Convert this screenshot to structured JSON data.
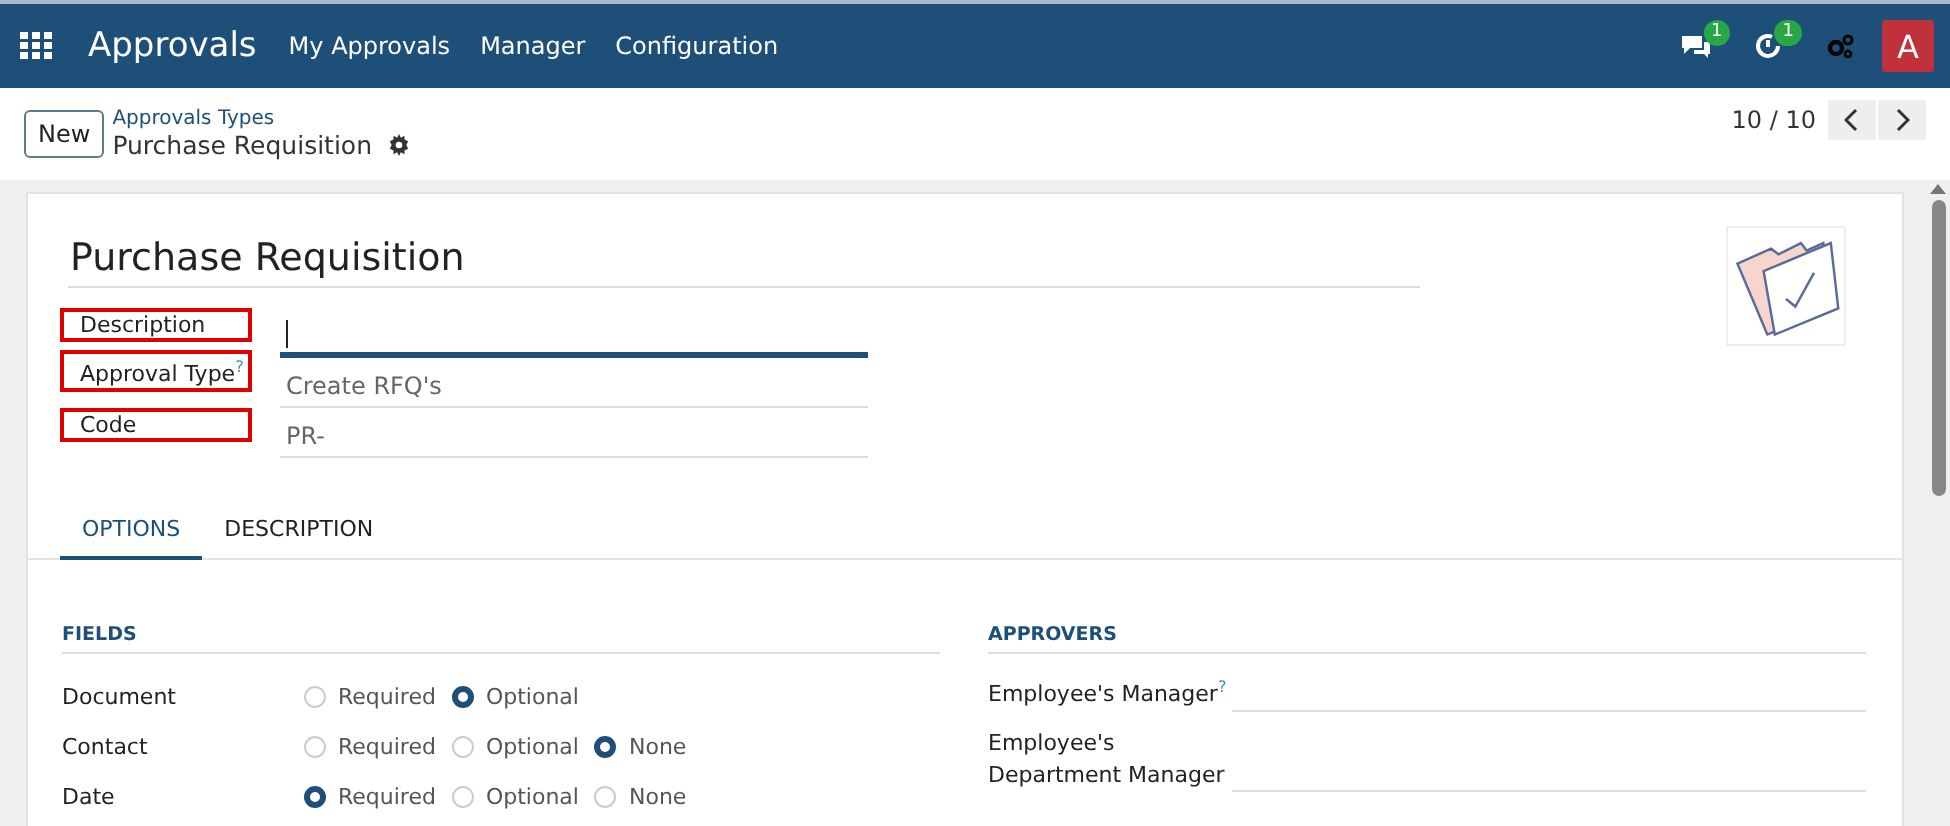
{
  "navbar": {
    "app_name": "Approvals",
    "menu": [
      "My Approvals",
      "Manager",
      "Configuration"
    ],
    "messages_badge": "1",
    "activities_badge": "1",
    "avatar": "A"
  },
  "control_panel": {
    "new_button": "New",
    "breadcrumb": "Approvals Types",
    "record_title": "Purchase Requisition",
    "pager": "10 / 10"
  },
  "form": {
    "title": "Purchase Requisition",
    "fields": [
      {
        "label": "Description",
        "highlighted": true,
        "focused": true
      },
      {
        "label": "Approval Type",
        "help": "?",
        "highlighted": true,
        "focused": false,
        "value": "Create RFQ's"
      },
      {
        "label": "Code",
        "highlighted": true,
        "focused": false,
        "value": "PR-"
      }
    ],
    "tabs": [
      {
        "label": "OPTIONS",
        "selected": true
      },
      {
        "label": "DESCRIPTION",
        "selected": false
      }
    ],
    "fields_section": {
      "title": "FIELDS",
      "rows": [
        {
          "label": "Document",
          "options": [
            {
              "label": "Required",
              "selected": false
            },
            {
              "label": "Optional",
              "selected": true
            }
          ]
        },
        {
          "label": "Contact",
          "options": [
            {
              "label": "Required",
              "selected": false
            },
            {
              "label": "Optional",
              "selected": false
            },
            {
              "label": "None",
              "selected": true
            }
          ]
        },
        {
          "label": "Date",
          "options": [
            {
              "label": "Required",
              "selected": true
            },
            {
              "label": "Optional",
              "selected": false
            },
            {
              "label": "None",
              "selected": false
            }
          ]
        }
      ]
    },
    "approvers_section": {
      "title": "APPROVERS",
      "rows": [
        {
          "label": "Employee's Manager",
          "help": "?"
        },
        {
          "label": "Employee's Department Manager"
        }
      ]
    }
  }
}
